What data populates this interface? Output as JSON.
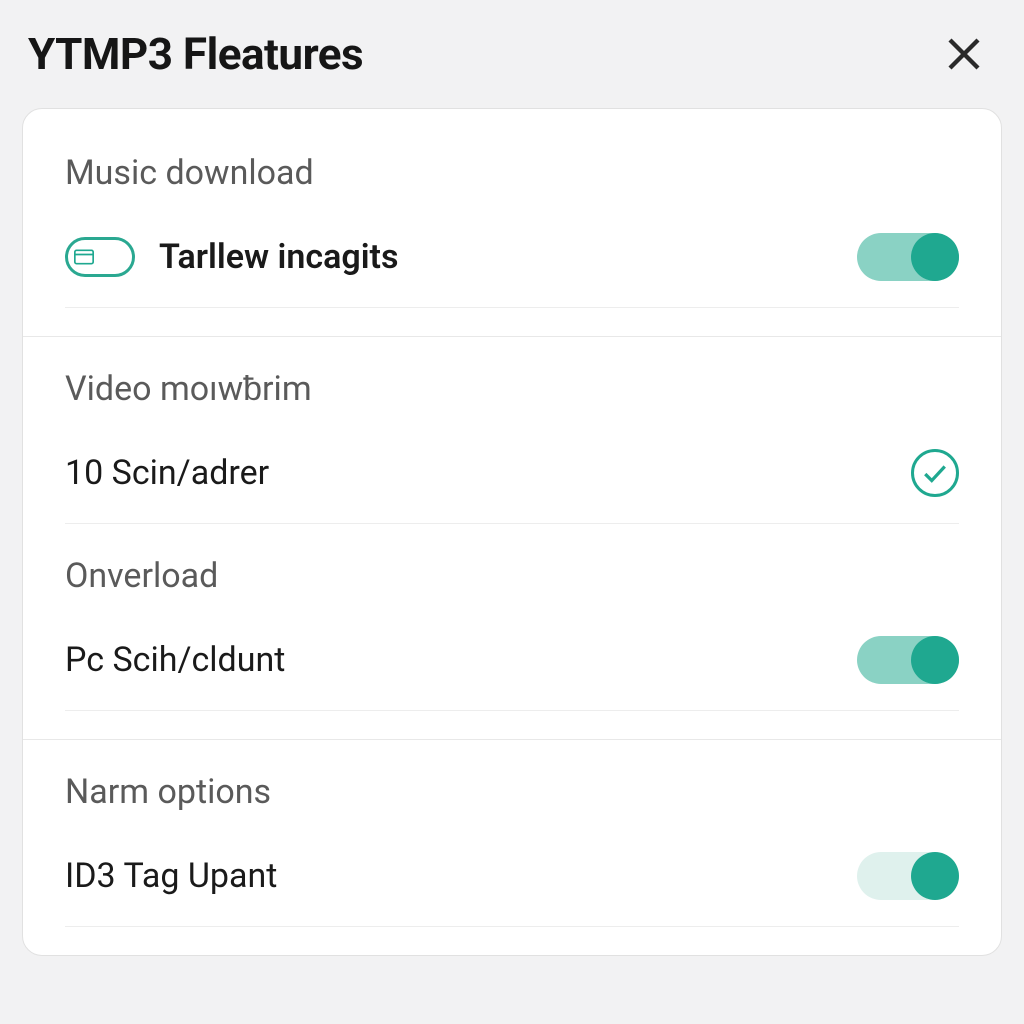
{
  "header": {
    "title": "YTMP3 Fleatures"
  },
  "sections": [
    {
      "title": "Music download",
      "rows": [
        {
          "label": "Tarllew incagits",
          "bold": true,
          "leftIcon": "pill-icon",
          "control": "toggle",
          "toggleState": "on"
        }
      ]
    },
    {
      "title": "Video moıwƀrim",
      "rows": [
        {
          "label": "10 Scin/adrer",
          "control": "check"
        }
      ]
    },
    {
      "title_inline": true,
      "title": "Onverload",
      "rows": [
        {
          "label": "Pc Scih/cldunt",
          "control": "toggle",
          "toggleState": "on"
        }
      ]
    },
    {
      "title": "Narm options",
      "rows": [
        {
          "label": "ID3 Tag Upant",
          "control": "toggle",
          "toggleState": "on",
          "toggleVariant": "light"
        }
      ]
    }
  ]
}
